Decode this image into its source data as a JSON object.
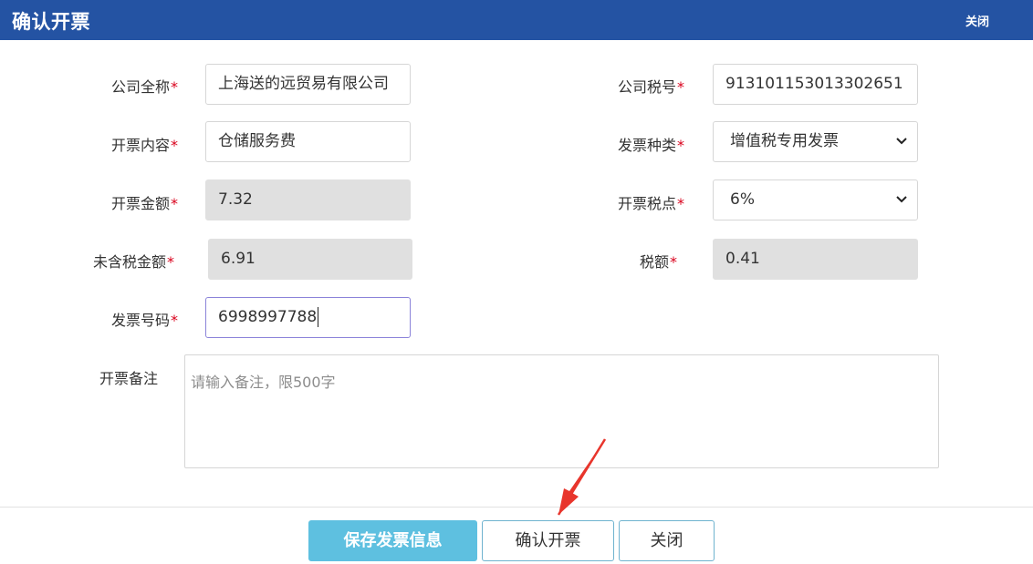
{
  "header": {
    "title": "确认开票",
    "close_label": "关闭"
  },
  "form": {
    "company_name": {
      "label": "公司全称",
      "required_mark": "*",
      "value": "上海送的远贸易有限公司"
    },
    "tax_number": {
      "label": "公司税号",
      "required_mark": "*",
      "value": "913101153013302651"
    },
    "invoice_content": {
      "label": "开票内容",
      "required_mark": "*",
      "value": "仓储服务费"
    },
    "invoice_type": {
      "label": "发票种类",
      "required_mark": "*",
      "selected": "增值税专用发票"
    },
    "invoice_amount": {
      "label": "开票金额",
      "required_mark": "*",
      "value": "7.32"
    },
    "tax_rate": {
      "label": "开票税点",
      "required_mark": "*",
      "selected": "6%"
    },
    "amount_excl_tax": {
      "label": "未含税金额",
      "required_mark": "*",
      "value": "6.91"
    },
    "tax_amount": {
      "label": "税额",
      "required_mark": "*",
      "value": "0.41"
    },
    "invoice_number": {
      "label": "发票号码",
      "required_mark": "*",
      "value": "6998997788"
    },
    "remark": {
      "label": "开票备注",
      "placeholder": "请输入备注，限500字"
    }
  },
  "footer": {
    "save_label": "保存发票信息",
    "confirm_label": "确认开票",
    "close_label": "关闭"
  },
  "colors": {
    "header_bg": "#2453a3",
    "primary_button": "#5ec0e0",
    "required": "#d9001b",
    "arrow": "#e8352c"
  }
}
